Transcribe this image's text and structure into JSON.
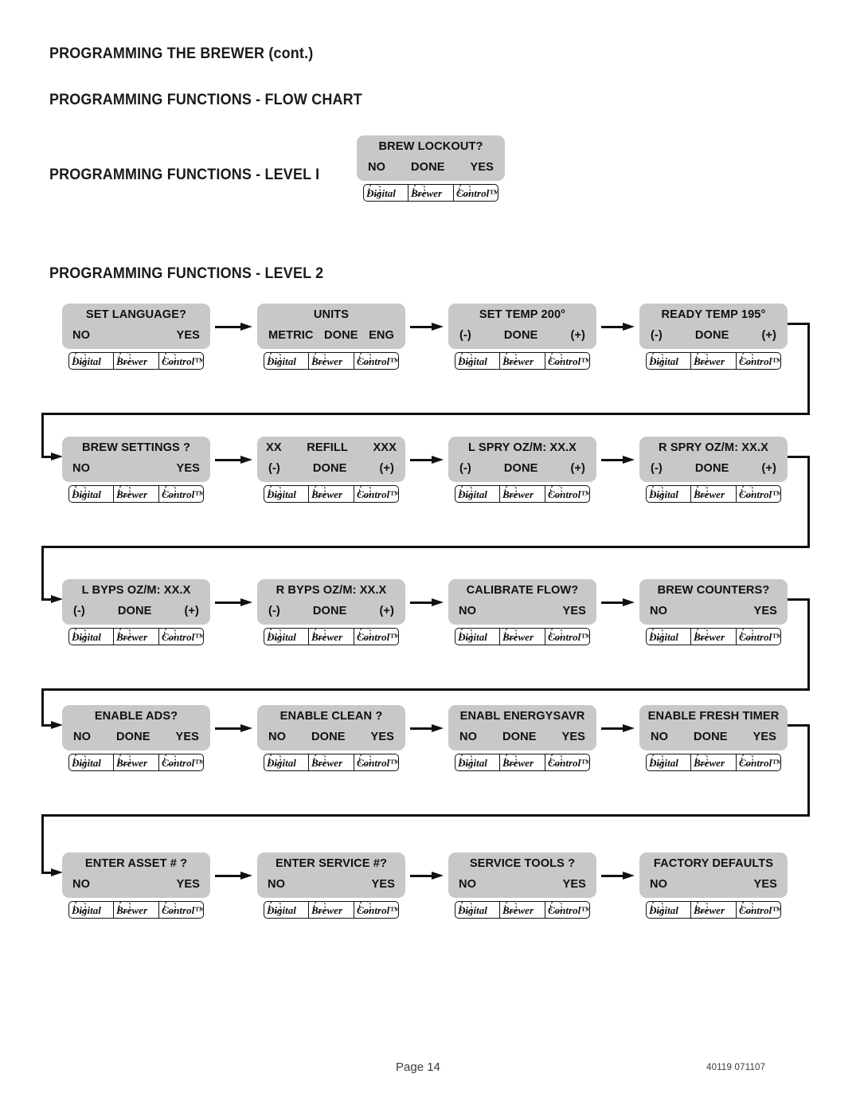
{
  "headings": {
    "title": "PROGRAMMING THE BREWER (cont.)",
    "flowchart": "PROGRAMMING FUNCTIONS - FLOW CHART",
    "level1": "PROGRAMMING FUNCTIONS - LEVEL  I",
    "level2": "PROGRAMMING FUNCTIONS - LEVEL  2"
  },
  "logo": {
    "part1": "Digital",
    "part2": "Brewer",
    "part3": "Control",
    "tm": "™"
  },
  "level1": {
    "node": {
      "title": "BREW LOCKOUT?",
      "opt_left": "NO",
      "opt_mid": "DONE",
      "opt_right": "YES"
    }
  },
  "level2": {
    "rows": [
      {
        "nodes": [
          {
            "title": "SET LANGUAGE?",
            "layout": "title-center",
            "opt_left": "NO",
            "opt_mid": "",
            "opt_right": "YES"
          },
          {
            "title": "UNITS",
            "layout": "title-center",
            "opt_left": "METRIC",
            "opt_mid": "DONE",
            "opt_right": "ENG"
          },
          {
            "title": "SET TEMP  200°",
            "layout": "title-center",
            "opt_left": "(-)",
            "opt_mid": "DONE",
            "opt_right": "(+)"
          },
          {
            "title": "READY TEMP 195°",
            "layout": "title-center",
            "opt_left": "(-)",
            "opt_mid": "DONE",
            "opt_right": "(+)"
          }
        ]
      },
      {
        "nodes": [
          {
            "title": "BREW SETTINGS ?",
            "layout": "title-center",
            "opt_left": "NO",
            "opt_mid": "",
            "opt_right": "YES"
          },
          {
            "title": "REFILL",
            "layout": "title-spread",
            "title_left": "XX",
            "title_right": "XXX",
            "opt_left": "(-)",
            "opt_mid": "DONE",
            "opt_right": "(+)"
          },
          {
            "title": "L  SPRY OZ/M:   XX.X",
            "layout": "title-center",
            "opt_left": "(-)",
            "opt_mid": "DONE",
            "opt_right": "(+)"
          },
          {
            "title": "R  SPRY OZ/M:   XX.X",
            "layout": "title-center",
            "opt_left": "(-)",
            "opt_mid": "DONE",
            "opt_right": "(+)"
          }
        ]
      },
      {
        "nodes": [
          {
            "title": "L  BYPS OZ/M:  XX.X",
            "layout": "title-center",
            "opt_left": "(-)",
            "opt_mid": "DONE",
            "opt_right": "(+)"
          },
          {
            "title": "R  BYPS OZ/M: XX.X",
            "layout": "title-center",
            "opt_left": "(-)",
            "opt_mid": "DONE",
            "opt_right": "(+)"
          },
          {
            "title": "CALIBRATE FLOW?",
            "layout": "title-center",
            "opt_left": "NO",
            "opt_mid": "",
            "opt_right": "YES"
          },
          {
            "title": "BREW COUNTERS?",
            "layout": "title-center",
            "opt_left": "NO",
            "opt_mid": "",
            "opt_right": "YES"
          }
        ]
      },
      {
        "nodes": [
          {
            "title": "ENABLE ADS?",
            "layout": "title-center",
            "opt_left": "NO",
            "opt_mid": "DONE",
            "opt_right": "YES"
          },
          {
            "title": "ENABLE CLEAN ?",
            "layout": "title-center",
            "opt_left": "NO",
            "opt_mid": "DONE",
            "opt_right": "YES"
          },
          {
            "title": "ENABL ENERGYSAVR",
            "layout": "title-center",
            "opt_left": "NO",
            "opt_mid": "DONE",
            "opt_right": "YES"
          },
          {
            "title": "ENABLE FRESH TIMER",
            "layout": "title-center",
            "opt_left": "NO",
            "opt_mid": "DONE",
            "opt_right": "YES"
          }
        ]
      },
      {
        "nodes": [
          {
            "title": "ENTER ASSET # ?",
            "layout": "title-center",
            "opt_left": "NO",
            "opt_mid": "",
            "opt_right": "YES"
          },
          {
            "title": "ENTER SERVICE #?",
            "layout": "title-center",
            "opt_left": "NO",
            "opt_mid": "",
            "opt_right": "YES"
          },
          {
            "title": "SERVICE TOOLS ?",
            "layout": "title-center",
            "opt_left": "NO",
            "opt_mid": "",
            "opt_right": "YES"
          },
          {
            "title": "FACTORY DEFAULTS",
            "layout": "title-center",
            "opt_left": "NO",
            "opt_mid": "",
            "opt_right": "YES"
          }
        ]
      }
    ]
  },
  "footer": {
    "page": "Page 14",
    "code": "40119 071107"
  }
}
